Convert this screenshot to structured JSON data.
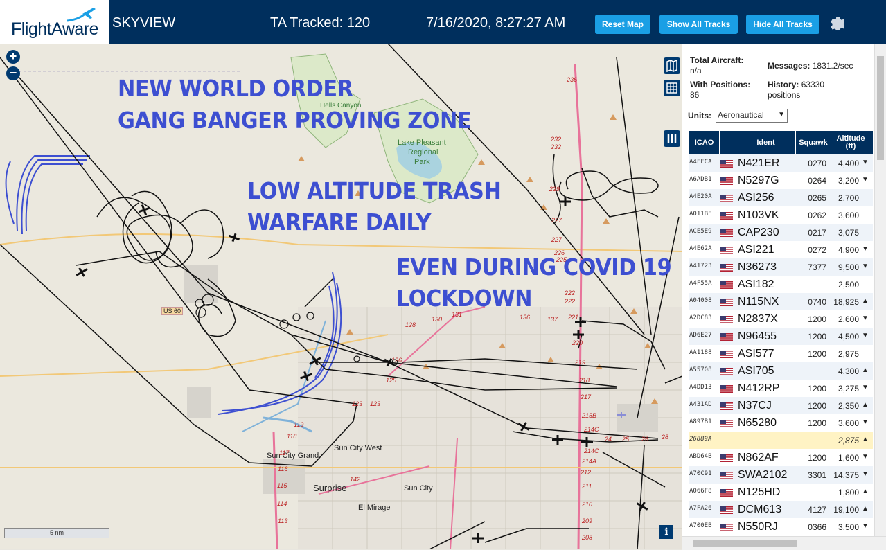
{
  "header": {
    "logo_text": "FlightAware",
    "app_name": "SKYVIEW",
    "tracked": "TA Tracked: 120",
    "datetime": "7/16/2020, 8:27:27 AM",
    "buttons": {
      "reset": "Reset Map",
      "show_all": "Show All Tracks",
      "hide_all": "Hide All Tracks"
    },
    "colors": {
      "bar": "#002f5d",
      "button": "#1a9fe5"
    }
  },
  "map": {
    "overlay": {
      "line1": "NEW WORLD ORDER",
      "line2": "GANG BANGER PROVING ZONE",
      "line3": "LOW ALTITUDE TRASH",
      "line4": "WARFARE DAILY",
      "line5": "EVEN DURING COVID 19",
      "line6": "LOCKDOWN",
      "color": "#3d4fd1"
    },
    "places": {
      "hells_canyon": "Hells Canyon",
      "lake": "Lake Pleasant",
      "regional": "Regional",
      "park": "Park",
      "sun_city_grand": "Sun City Grand",
      "sun_city_west": "Sun City West",
      "surprise": "Surprise",
      "sun_city": "Sun City",
      "el_mirage": "El Mirage",
      "us60": "US 60"
    },
    "roads": [
      "236",
      "232",
      "232",
      "229",
      "227",
      "227",
      "226",
      "225",
      "222",
      "222",
      "221",
      "220",
      "219",
      "218",
      "217",
      "215B",
      "214C",
      "214C",
      "214A",
      "212",
      "211",
      "210",
      "209",
      "208",
      "131",
      "130",
      "128",
      "136",
      "137",
      "126",
      "125",
      "123",
      "123",
      "119",
      "118",
      "117",
      "116",
      "115",
      "114",
      "113",
      "142",
      "24",
      "25",
      "26",
      "28"
    ],
    "scale": "5 nm",
    "zoom_in": "+",
    "zoom_out": "−",
    "info": "i"
  },
  "panel": {
    "total_label": "Total Aircraft:",
    "total_value": "n/a",
    "messages_label": "Messages:",
    "messages_value": "1831.2/sec",
    "positions_label": "With Positions:",
    "positions_value": "86",
    "history_label": "History:",
    "history_value": "63330",
    "history_unit": "positions",
    "units_label": "Units:",
    "units_value": "Aeronautical",
    "columns": [
      "ICAO",
      "",
      "Ident",
      "Squawk",
      "Altitude (ft)"
    ],
    "rows": [
      {
        "icao": "A4FFCA",
        "ident": "N421ER",
        "squawk": "0270",
        "alt": "4,400",
        "dir": "▼"
      },
      {
        "icao": "A6ADB1",
        "ident": "N5297G",
        "squawk": "0264",
        "alt": "3,200",
        "dir": "▼"
      },
      {
        "icao": "A4E20A",
        "ident": "ASI256",
        "squawk": "0265",
        "alt": "2,700",
        "dir": ""
      },
      {
        "icao": "A011BE",
        "ident": "N103VK",
        "squawk": "0262",
        "alt": "3,600",
        "dir": ""
      },
      {
        "icao": "ACE5E9",
        "ident": "CAP230",
        "squawk": "0217",
        "alt": "3,075",
        "dir": ""
      },
      {
        "icao": "A4E62A",
        "ident": "ASI221",
        "squawk": "0272",
        "alt": "4,900",
        "dir": "▼"
      },
      {
        "icao": "A41723",
        "ident": "N36273",
        "squawk": "7377",
        "alt": "9,500",
        "dir": "▼"
      },
      {
        "icao": "A4F55A",
        "ident": "ASI182",
        "squawk": "",
        "alt": "2,500",
        "dir": ""
      },
      {
        "icao": "A04008",
        "ident": "N115NX",
        "squawk": "0740",
        "alt": "18,925",
        "dir": "▲"
      },
      {
        "icao": "A2DC83",
        "ident": "N2837X",
        "squawk": "1200",
        "alt": "2,600",
        "dir": "▼"
      },
      {
        "icao": "AD6E27",
        "ident": "N96455",
        "squawk": "1200",
        "alt": "4,500",
        "dir": "▼"
      },
      {
        "icao": "AA1188",
        "ident": "ASI577",
        "squawk": "1200",
        "alt": "2,975",
        "dir": ""
      },
      {
        "icao": "A55708",
        "ident": "ASI705",
        "squawk": "",
        "alt": "4,300",
        "dir": "▲"
      },
      {
        "icao": "A4DD13",
        "ident": "N412RP",
        "squawk": "1200",
        "alt": "3,275",
        "dir": "▼"
      },
      {
        "icao": "A431AD",
        "ident": "N37CJ",
        "squawk": "1200",
        "alt": "2,350",
        "dir": "▲"
      },
      {
        "icao": "A897B1",
        "ident": "N65280",
        "squawk": "1200",
        "alt": "3,600",
        "dir": "▼"
      },
      {
        "icao": "26889A",
        "ident": "",
        "squawk": "",
        "alt": "2,875",
        "dir": "▲",
        "selected": true
      },
      {
        "icao": "ABD64B",
        "ident": "N862AF",
        "squawk": "1200",
        "alt": "1,600",
        "dir": "▼"
      },
      {
        "icao": "A70C91",
        "ident": "SWA2102",
        "squawk": "3301",
        "alt": "14,375",
        "dir": "▼"
      },
      {
        "icao": "A066F8",
        "ident": "N125HD",
        "squawk": "",
        "alt": "1,800",
        "dir": "▲"
      },
      {
        "icao": "A7FA26",
        "ident": "DCM613",
        "squawk": "4127",
        "alt": "19,100",
        "dir": "▲"
      },
      {
        "icao": "A700EB",
        "ident": "N550RJ",
        "squawk": "0366",
        "alt": "3,500",
        "dir": "▼"
      }
    ]
  }
}
